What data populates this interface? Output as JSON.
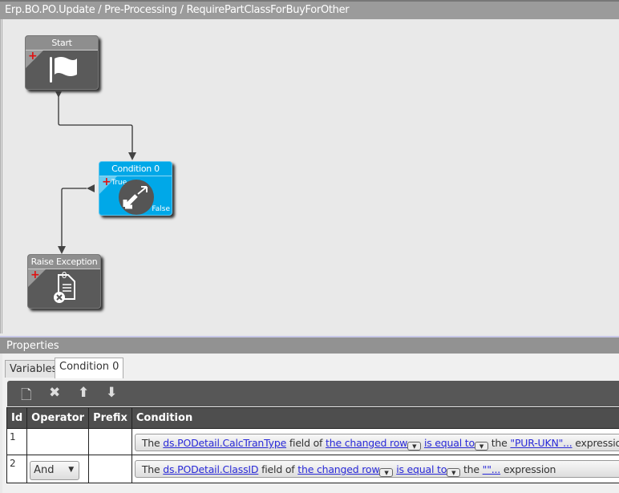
{
  "title": "Erp.BO.PO.Update / Pre-Processing / RequirePartClassForBuyForOther",
  "nodes": {
    "start": {
      "label": "Start"
    },
    "condition": {
      "label": "Condition 0",
      "true_label": "True",
      "false_label": "False"
    },
    "raise": {
      "label": "Raise Exception 0"
    }
  },
  "properties": {
    "title": "Properties",
    "tabs": [
      "Variables",
      "Condition 0"
    ],
    "columns": [
      "Id",
      "Operator",
      "Prefix",
      "Condition"
    ],
    "rows": [
      {
        "id": "1",
        "operator": "",
        "prefix": "",
        "parts": {
          "the": "The",
          "field": "ds.PODetail.CalcTranType",
          "fieldof": "field of",
          "row": "the changed row",
          "op": "is equal to",
          "the2": "the",
          "value": "\"PUR-UKN\"...",
          "expr": "expression"
        }
      },
      {
        "id": "2",
        "operator": "And",
        "prefix": "",
        "parts": {
          "the": "The",
          "field": "ds.PODetail.ClassID",
          "fieldof": "field of",
          "row": "the changed row",
          "op": "is equal to",
          "the2": "the",
          "value": "\"\"...",
          "expr": "expression"
        }
      }
    ]
  }
}
